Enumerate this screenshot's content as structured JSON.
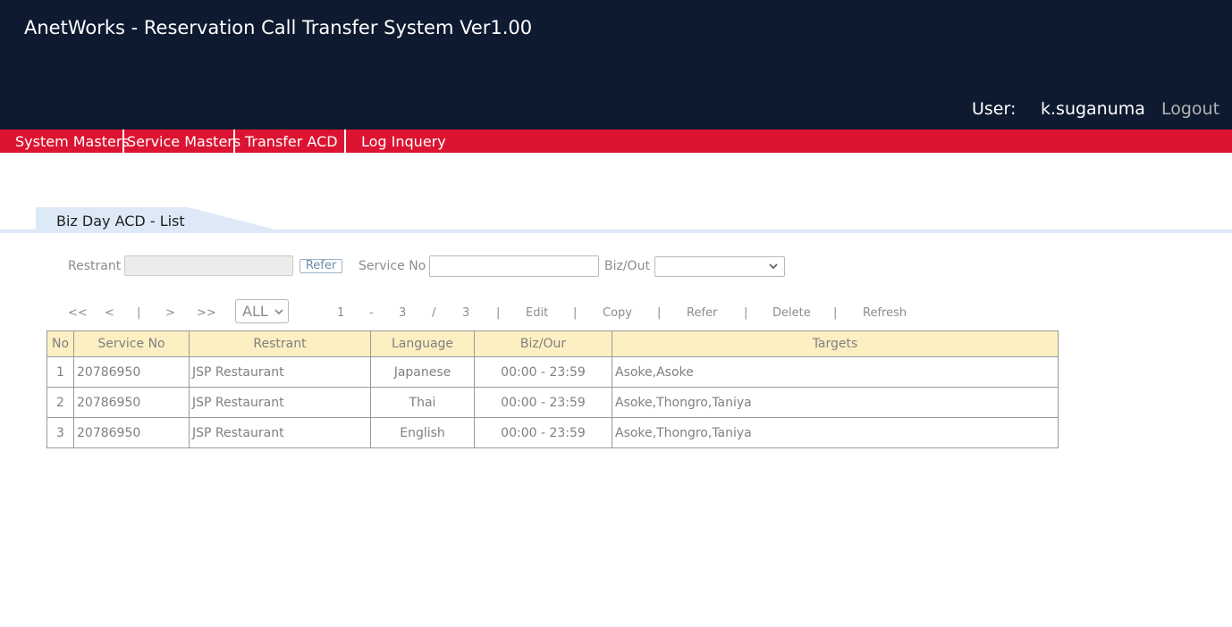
{
  "header": {
    "title": "AnetWorks - Reservation Call Transfer System Ver1.00",
    "user_label": "User:",
    "user_name": "k.suganuma",
    "logout": "Logout"
  },
  "menu": {
    "items": [
      "System Masters",
      "Service Masters",
      "Transfer ACD",
      "Log Inquery"
    ]
  },
  "tab": {
    "label": "Biz Day ACD - List"
  },
  "filter": {
    "restrant_label": "Restrant",
    "restrant_value": "",
    "refer_button": "Refer",
    "service_no_label": "Service No",
    "service_no_value": "",
    "biz_out_label": "Biz/Out",
    "biz_out_selected": ""
  },
  "toolbar": {
    "first": "<<",
    "prev": "<",
    "sep": "|",
    "next": ">",
    "last": ">>",
    "page_size": "ALL",
    "range_start": "1",
    "range_dash": "-",
    "range_end": "3",
    "slash": "/",
    "total": "3",
    "edit": "Edit",
    "copy": "Copy",
    "refer": "Refer",
    "delete": "Delete",
    "refresh": "Refresh"
  },
  "table": {
    "columns": [
      "No",
      "Service No",
      "Restrant",
      "Language",
      "Biz/Our",
      "Targets"
    ],
    "rows": [
      [
        "1",
        "20786950",
        "JSP Restaurant",
        "Japanese",
        "00:00 - 23:59",
        "Asoke,Asoke"
      ],
      [
        "2",
        "20786950",
        "JSP Restaurant",
        "Thai",
        "00:00 - 23:59",
        "Asoke,Thongro,Taniya"
      ],
      [
        "3",
        "20786950",
        "JSP Restaurant",
        "English",
        "00:00 - 23:59",
        "Asoke,Thongro,Taniya"
      ]
    ]
  },
  "colors": {
    "header_bg": "#0d1a2f",
    "menu_bg": "#dc1431",
    "tab_bg": "#dde9f7",
    "table_header_bg": "#fcefc2"
  },
  "icons": {
    "select_chevron": "chevron-down-icon"
  }
}
